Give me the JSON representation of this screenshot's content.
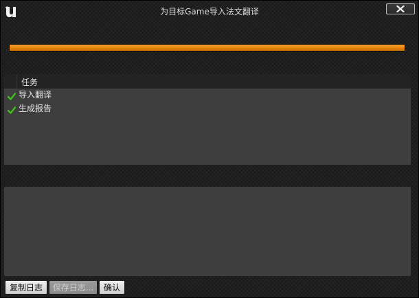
{
  "window": {
    "title": "为目标Game导入法文翻译",
    "close_icon": "close-icon",
    "logo_icon": "unreal-logo-icon"
  },
  "progress": {
    "fraction": 1.0,
    "color": "#e8860b"
  },
  "task_list": {
    "column_header": "任务",
    "items": [
      {
        "label": "导入翻译",
        "status": "done",
        "icon": "checkmark-icon"
      },
      {
        "label": "生成报告",
        "status": "done",
        "icon": "checkmark-icon"
      }
    ],
    "check_color": "#3fc21a"
  },
  "log": {
    "text": ""
  },
  "buttons": {
    "copy_log": "复制日志",
    "save_log": "保存日志...",
    "confirm": "确认"
  }
}
